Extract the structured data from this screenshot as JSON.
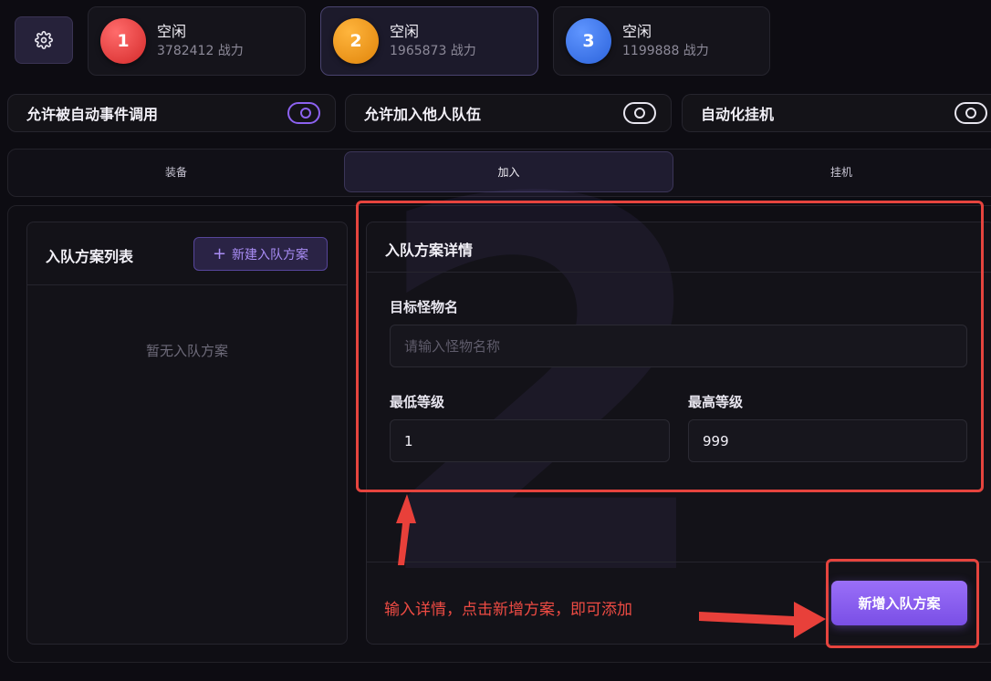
{
  "characters": [
    {
      "number": "1",
      "status": "空闲",
      "power": "3782412 战力",
      "color": "#e53a3a"
    },
    {
      "number": "2",
      "status": "空闲",
      "power": "1965873 战力",
      "color": "#ef9310"
    },
    {
      "number": "3",
      "status": "空闲",
      "power": "1199888 战力",
      "color": "#3a78f0"
    }
  ],
  "toggles": [
    {
      "label": "允许被自动事件调用",
      "on": true
    },
    {
      "label": "允许加入他人队伍",
      "on": false
    },
    {
      "label": "自动化挂机",
      "on": false
    }
  ],
  "tabs": [
    {
      "label": "装备"
    },
    {
      "label": "加入",
      "active": true
    },
    {
      "label": "挂机"
    }
  ],
  "list_panel": {
    "title": "入队方案列表",
    "new_button": "新建入队方案",
    "empty_text": "暂无入队方案"
  },
  "detail_panel": {
    "title": "入队方案详情",
    "watermark": "2",
    "target_label": "目标怪物名",
    "target_placeholder": "请输入怪物名称",
    "target_value": "",
    "min_level_label": "最低等级",
    "min_level_value": "1",
    "max_level_label": "最高等级",
    "max_level_value": "999",
    "add_button": "新增入队方案"
  },
  "annotation": {
    "text": "输入详情，点击新增方案，即可添加",
    "color": "#e6443e"
  }
}
